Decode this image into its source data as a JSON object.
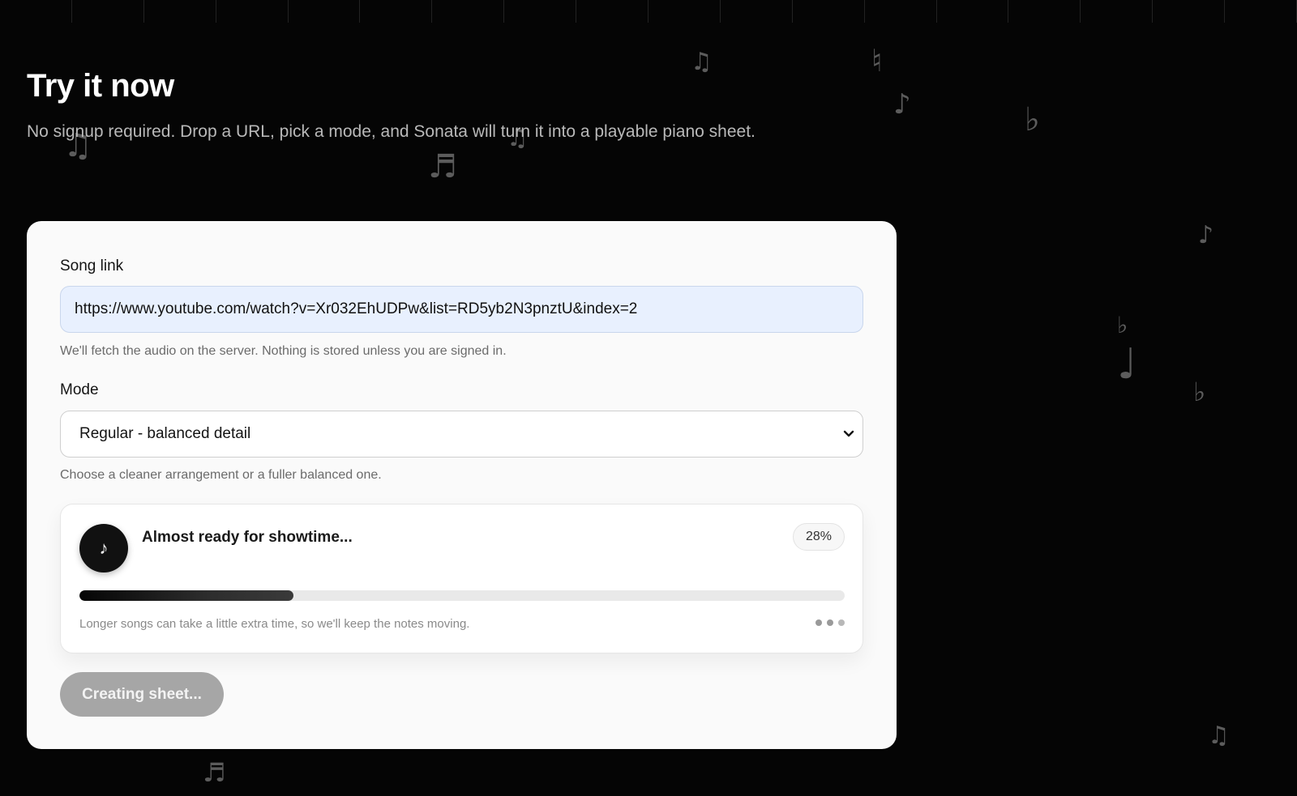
{
  "hero": {
    "title": "Try it now",
    "subtitle": "No signup required. Drop a URL, pick a mode, and Sonata will turn it into a playable piano sheet."
  },
  "form": {
    "song_link": {
      "label": "Song link",
      "value": "https://www.youtube.com/watch?v=Xr032EhUDPw&list=RD5yb2N3pnztU&index=2",
      "hint": "We'll fetch the audio on the server. Nothing is stored unless you are signed in."
    },
    "mode": {
      "label": "Mode",
      "selected": "Regular - balanced detail",
      "hint": "Choose a cleaner arrangement or a fuller balanced one."
    },
    "progress": {
      "icon": "music-note-icon",
      "icon_glyph": "♪",
      "status": "Almost ready for showtime...",
      "percent_label": "28%",
      "percent": 28,
      "hint": "Longer songs can take a little extra time, so we'll keep the notes moving."
    },
    "submit_label": "Creating sheet..."
  },
  "colors": {
    "background": "#050505",
    "card": "#fafafa",
    "input_fill": "#e8f0fe",
    "progress_fill": "#111111",
    "button_disabled": "#a6a6a6"
  }
}
